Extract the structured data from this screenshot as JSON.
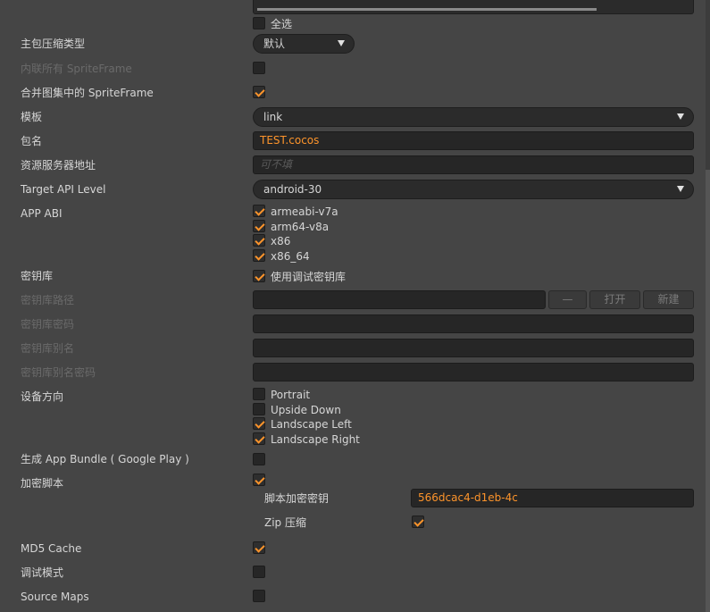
{
  "top_partial": {
    "select_all_label": "全选"
  },
  "fields": {
    "compression": {
      "label": "主包压缩类型",
      "value": "默认"
    },
    "inline_sprite": {
      "label": "内联所有 SpriteFrame"
    },
    "merge_sprite": {
      "label": "合并图集中的 SpriteFrame"
    },
    "template": {
      "label": "模板",
      "value": "link"
    },
    "package_name": {
      "label": "包名",
      "value": "TEST.cocos"
    },
    "resource_server": {
      "label": "资源服务器地址",
      "placeholder": "可不填"
    },
    "target_api": {
      "label": "Target API Level",
      "value": "android-30"
    },
    "app_abi": {
      "label": "APP ABI",
      "options": [
        "armeabi-v7a",
        "arm64-v8a",
        "x86",
        "x86_64"
      ]
    },
    "keystore": {
      "label": "密钥库",
      "option": "使用调试密钥库"
    },
    "keystore_path": {
      "label": "密钥库路径",
      "btn_dash": "—",
      "btn_open": "打开",
      "btn_new": "新建"
    },
    "keystore_password": {
      "label": "密钥库密码"
    },
    "keystore_alias": {
      "label": "密钥库别名"
    },
    "keystore_alias_password": {
      "label": "密钥库别名密码"
    },
    "orientation": {
      "label": "设备方向",
      "options": [
        "Portrait",
        "Upside Down",
        "Landscape Left",
        "Landscape Right"
      ]
    },
    "app_bundle": {
      "label": "生成 App Bundle ( Google Play )"
    },
    "encrypt_script": {
      "label": "加密脚本",
      "key_label": "脚本加密密钥",
      "key_value": "566dcac4-d1eb-4c",
      "zip_label": "Zip 压缩"
    },
    "md5": {
      "label": "MD5 Cache"
    },
    "debug": {
      "label": "调试模式"
    },
    "source_maps": {
      "label": "Source Maps"
    }
  }
}
